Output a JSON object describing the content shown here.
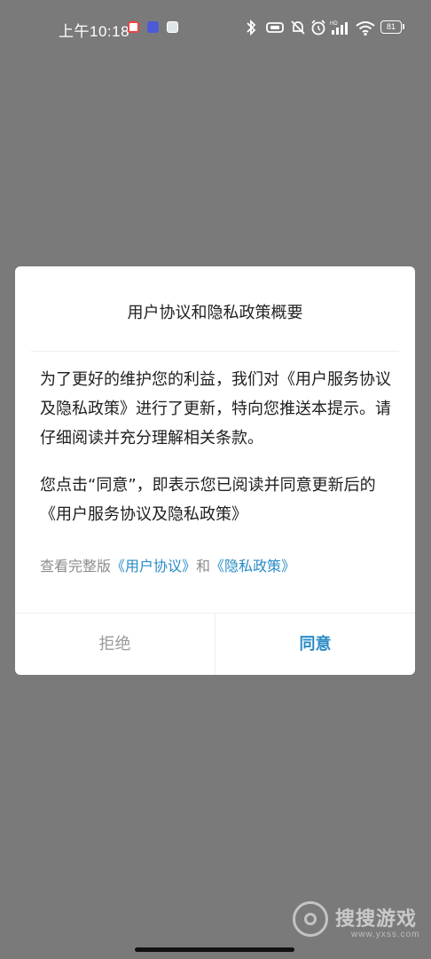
{
  "status_bar": {
    "time": "上午10:18",
    "battery_level": "81",
    "notification_icons": [
      "netease-music-icon",
      "app-icon",
      "message-icon"
    ],
    "system_icons": [
      "bluetooth-icon",
      "vibrate-icon",
      "mute-icon",
      "alarm-icon",
      "signal-icon",
      "wifi-icon",
      "battery-icon"
    ]
  },
  "dialog": {
    "title": "用户协议和隐私政策概要",
    "paragraph1": "为了更好的维护您的利益，我们对《用户服务协议及隐私政策》进行了更新，特向您推送本提示。请仔细阅读并充分理解相关条款。",
    "paragraph2": "您点击“同意”，即表示您已阅读并同意更新后的 《用户服务协议及隐私政策》",
    "links": {
      "prefix": "查看完整版",
      "user_agreement": "《用户协议》",
      "joiner": "和",
      "privacy_policy": "《隐私政策》"
    },
    "buttons": {
      "reject": "拒绝",
      "agree": "同意"
    }
  },
  "watermark": {
    "text": "搜搜游戏",
    "sub": "www.yxss.com"
  },
  "colors": {
    "overlay": "#7a7a7a",
    "accent": "#2a8bc6",
    "muted": "#9a9a9a"
  }
}
